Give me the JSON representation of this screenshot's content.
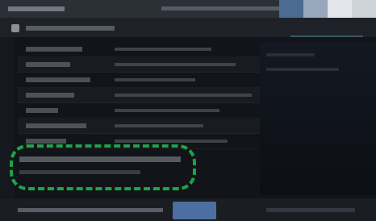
{
  "window": {
    "title": "",
    "controls": [
      "minimize",
      "maximize",
      "restore",
      "close"
    ]
  },
  "address_bar": {
    "text": ""
  },
  "list": {
    "rows": [
      "",
      "",
      "",
      "",
      "",
      "",
      "",
      "",
      "",
      ""
    ]
  },
  "highlight": {
    "style": "dashed-green",
    "color": "#1fa34a",
    "label": ""
  },
  "footer": {
    "primary_label": "",
    "button_label": ""
  },
  "colors": {
    "background": "#111418",
    "titlebar": "#2b2f36",
    "accent": "#4d6ea0",
    "highlight": "#1fa34a"
  }
}
